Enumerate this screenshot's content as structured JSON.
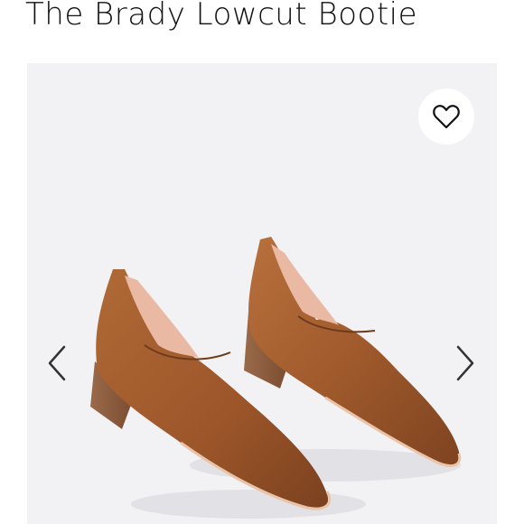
{
  "product": {
    "title": "The Brady Lowcut Bootie"
  },
  "gallery": {
    "favorite_icon": "heart-outline-icon",
    "prev_icon": "chevron-left-icon",
    "next_icon": "chevron-right-icon",
    "photo_subject": "pair of brown leather lowcut booties",
    "colors": {
      "background": "#f2f2f4",
      "leather": "#a05a2c",
      "heel": "#8a5a3c",
      "lining": "#eab9a4"
    }
  }
}
